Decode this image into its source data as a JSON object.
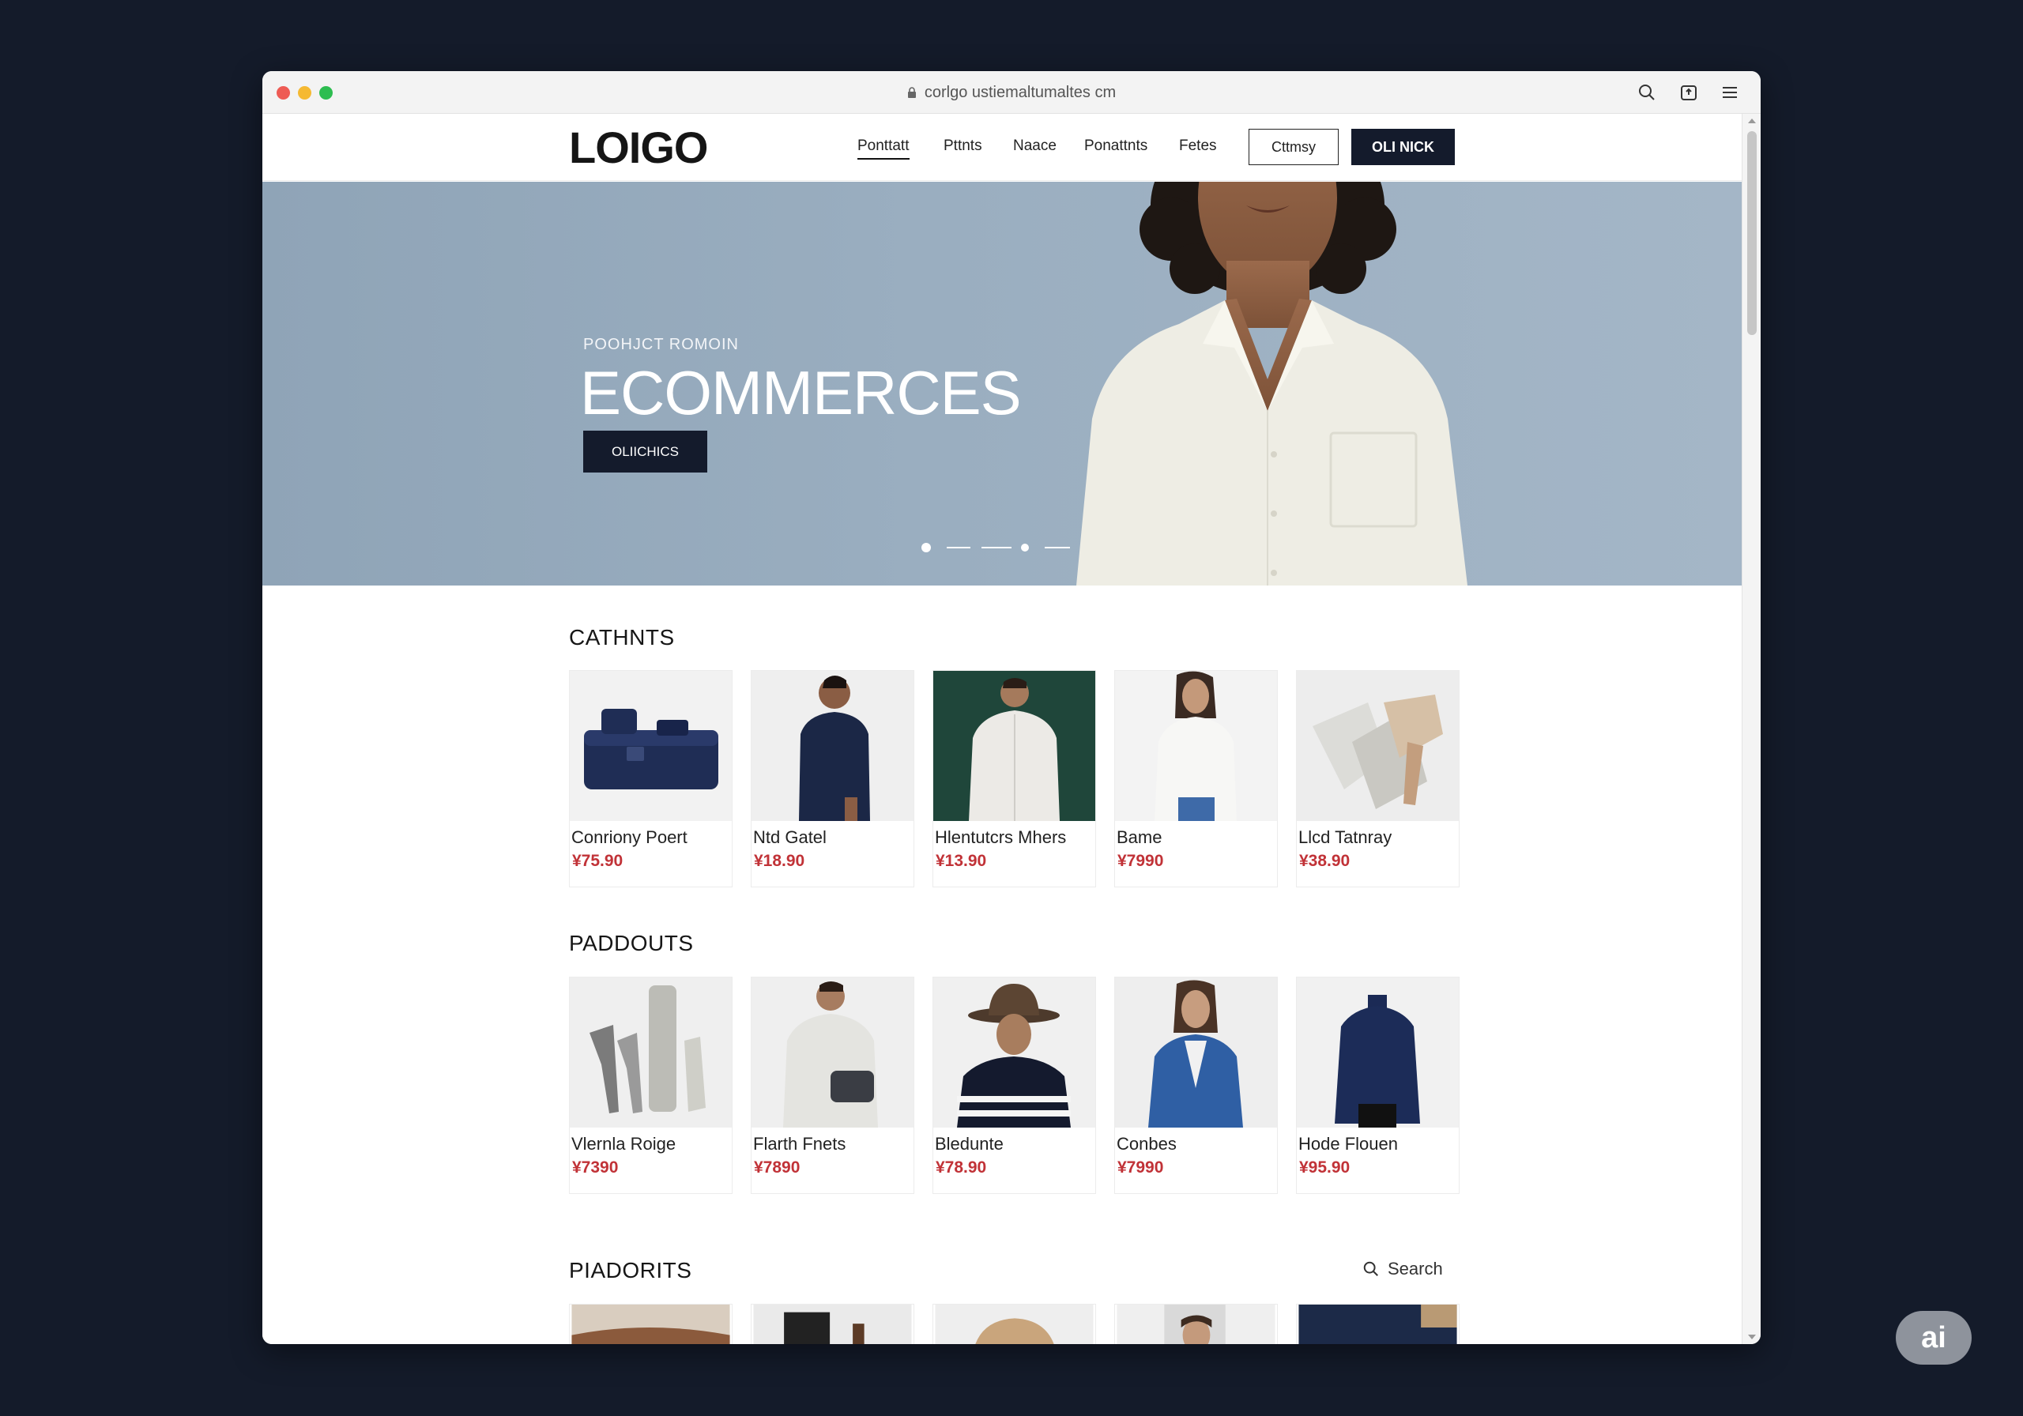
{
  "browser": {
    "url": "corlgo ustiemaltumaltes cm",
    "icons": [
      "search-icon",
      "share-icon",
      "menu-icon"
    ]
  },
  "header": {
    "logo": "LOIGO",
    "nav": [
      "Ponttatt",
      "Pttnts",
      "Naace",
      "Ponattnts",
      "Fetes"
    ],
    "outline_button": "Cttmsy",
    "dark_button": "OLI NICK"
  },
  "hero": {
    "eyebrow": "POOHJCT ROMOIN",
    "title": "ECOMMERCES",
    "button": "OLIICHICS"
  },
  "sections": [
    {
      "title": "CATHNTS",
      "products": [
        {
          "name": "Conriony Poert",
          "price": "¥75.90"
        },
        {
          "name": "Ntd Gatel",
          "price": "¥18.90"
        },
        {
          "name": "Hlentutcrs Mhers",
          "price": "¥13.90"
        },
        {
          "name": "Bame",
          "price": "¥7990"
        },
        {
          "name": "Llcd Tatnray",
          "price": "¥38.90"
        }
      ]
    },
    {
      "title": "PADDOUTS",
      "products": [
        {
          "name": "Vlernla Roige",
          "price": "¥7390"
        },
        {
          "name": "Flarth Fnets",
          "price": "¥7890"
        },
        {
          "name": "Bledunte",
          "price": "¥78.90"
        },
        {
          "name": "Conbes",
          "price": "¥7990"
        },
        {
          "name": "Hode Flouen",
          "price": "¥95.90"
        }
      ]
    },
    {
      "title": "PIADORITS",
      "search_label": "Search"
    }
  ],
  "badge": "ai",
  "colors": {
    "backdrop": "#141b2a",
    "accent_dark": "#141b2c",
    "price_red": "#c13237",
    "hero_blue": "#9aaec0"
  }
}
